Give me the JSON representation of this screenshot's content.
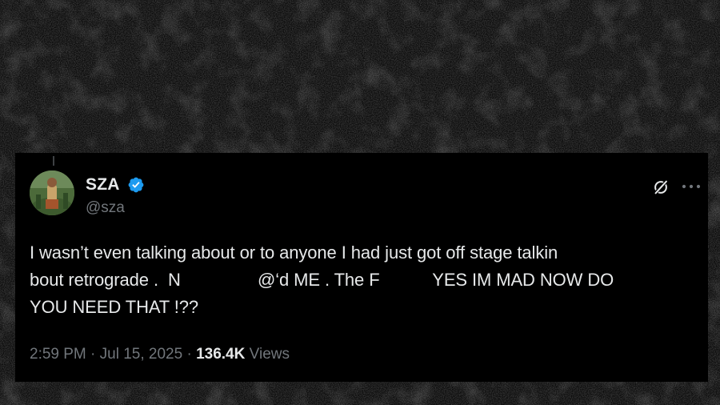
{
  "tweet": {
    "author": {
      "display_name": "SZA",
      "handle": "@sza",
      "verified": true,
      "verified_color": "#1d9bf0"
    },
    "text_lines": [
      "I wasn’t even talking about or to anyone I had just got off stage talkin",
      "bout retrograde .  N                @‘d ME . The F           YES IM MAD NOW DO",
      "YOU NEED THAT !??"
    ],
    "time": "2:59 PM",
    "separator": "·",
    "date": "Jul 15, 2025",
    "views_count": "136.4K",
    "views_label": "Views"
  },
  "icons": {
    "verified": "verified-badge-icon",
    "grok": "grok-icon",
    "more": "more-options-icon"
  },
  "colors": {
    "background": "#0a0a0a",
    "card": "#000000",
    "text_primary": "#e7e9ea",
    "text_secondary": "#71767b"
  }
}
